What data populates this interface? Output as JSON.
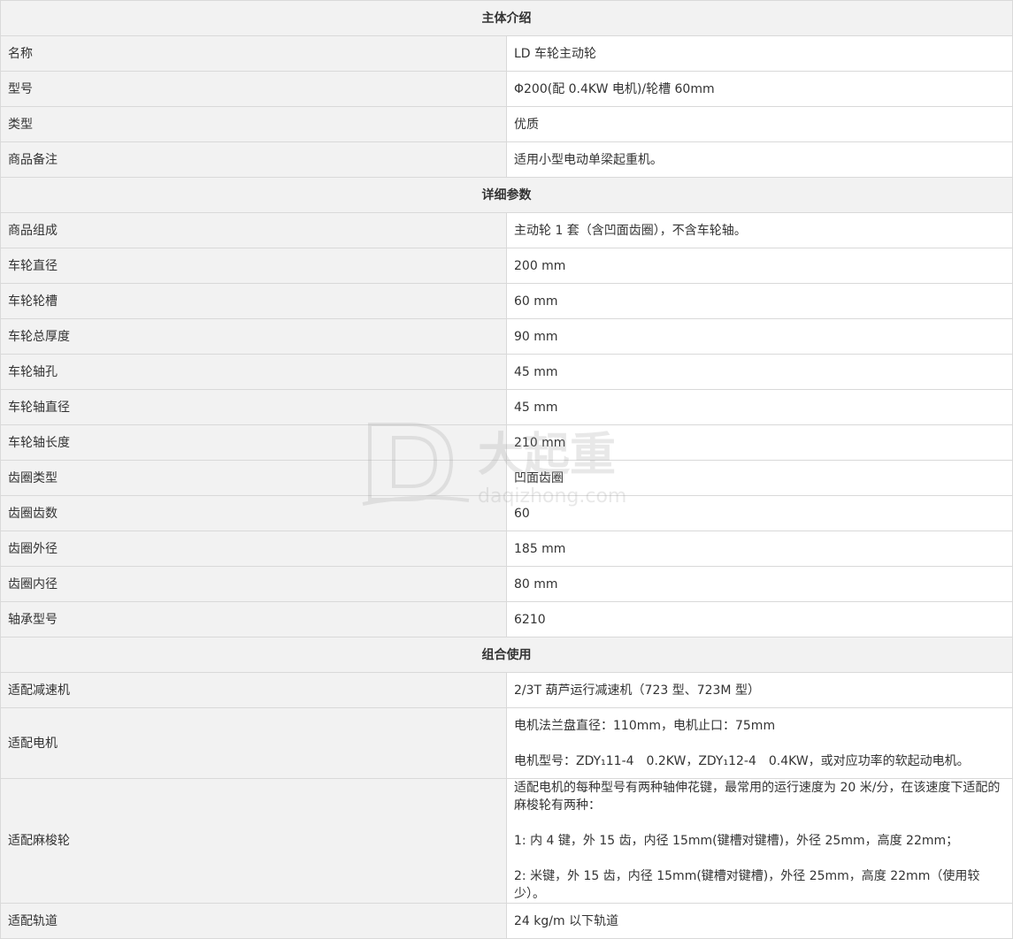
{
  "sections": [
    {
      "title": "主体介绍",
      "rows": [
        {
          "label": "名称",
          "value": "LD 车轮主动轮"
        },
        {
          "label": "型号",
          "value": "Φ200(配 0.4KW 电机)/轮槽 60mm"
        },
        {
          "label": "类型",
          "value": "优质"
        },
        {
          "label": "商品备注",
          "value": "适用小型电动单梁起重机。"
        }
      ]
    },
    {
      "title": "详细参数",
      "rows": [
        {
          "label": "商品组成",
          "value": "主动轮 1 套（含凹面齿圈），不含车轮轴。"
        },
        {
          "label": "车轮直径",
          "value": "200 mm"
        },
        {
          "label": "车轮轮槽",
          "value": "60 mm"
        },
        {
          "label": "车轮总厚度",
          "value": "90 mm"
        },
        {
          "label": "车轮轴孔",
          "value": "45 mm"
        },
        {
          "label": "车轮轴直径",
          "value": "45 mm"
        },
        {
          "label": "车轮轴长度",
          "value": "210 mm"
        },
        {
          "label": "齿圈类型",
          "value": "凹面齿圈"
        },
        {
          "label": "齿圈齿数",
          "value": "60"
        },
        {
          "label": "齿圈外径",
          "value": "185 mm"
        },
        {
          "label": "齿圈内径",
          "value": "80 mm"
        },
        {
          "label": "轴承型号",
          "value": "6210"
        }
      ]
    },
    {
      "title": "组合使用",
      "rows": [
        {
          "label": "适配减速机",
          "value": "2/3T 葫芦运行减速机（723 型、723M 型）"
        },
        {
          "label": "适配电机",
          "lines": [
            "电机法兰盘直径：110mm，电机止口：75mm",
            "电机型号：ZDY₁11-4　0.2KW，ZDY₁12-4　0.4KW，或对应功率的软起动电机。"
          ]
        },
        {
          "label": "适配麻梭轮",
          "lines": [
            "适配电机的每种型号有两种轴伸花键，最常用的运行速度为 20 米/分，在该速度下适配的麻梭轮有两种：",
            "1:  内 4 键，外 15 齿，内径 15mm(键槽对键槽)，外径 25mm，高度 22mm；",
            "2:  米键，外 15 齿，内径 15mm(键槽对键槽)，外径 25mm，高度 22mm（使用较少）。"
          ]
        },
        {
          "label": "适配轨道",
          "value": "24 kg/m 以下轨道"
        }
      ]
    }
  ],
  "watermark": {
    "brand": "大起重",
    "domain": "daqizhong.com"
  }
}
